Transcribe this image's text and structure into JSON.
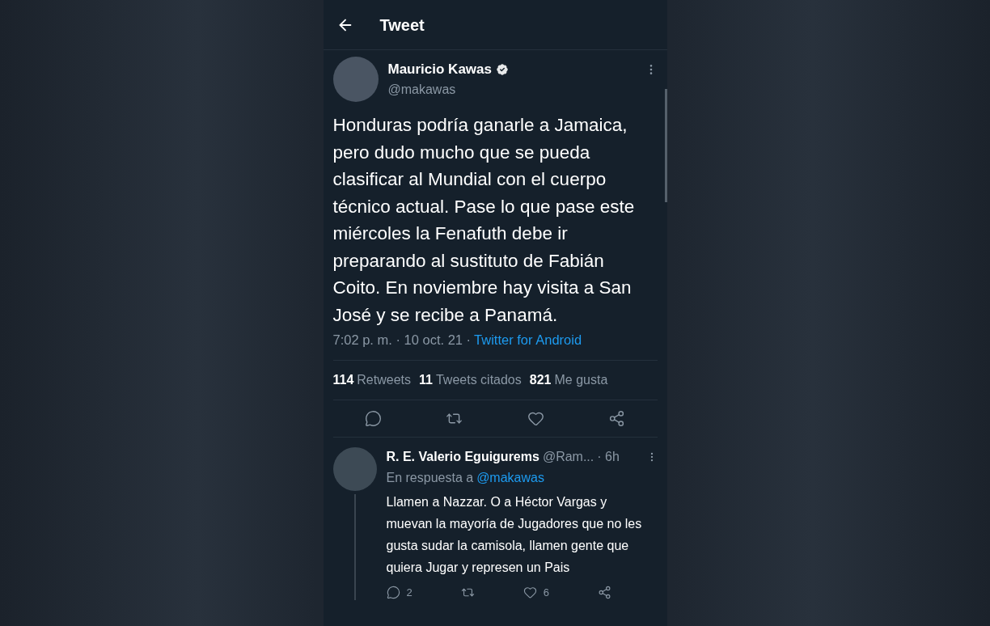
{
  "header": {
    "title": "Tweet"
  },
  "tweet": {
    "name": "Mauricio Kawas",
    "verified": true,
    "handle": "@makawas",
    "text": "Honduras podría ganarle a Jamaica, pero dudo mucho que se pueda clasificar al Mundial con el cuerpo técnico actual. Pase lo que pase este miércoles la Fenafuth debe ir preparando al sustituto de Fabián Coito. En noviembre hay visita a San José y se recibe a Panamá.",
    "time": "7:02 p. m. · 10 oct. 21 ·",
    "source": "Twitter for Android",
    "stats": [
      {
        "count": "114",
        "label": "Retweets"
      },
      {
        "count": "11",
        "label": "Tweets citados"
      },
      {
        "count": "821",
        "label": "Me gusta"
      }
    ],
    "actions": [
      {
        "kind": "reply"
      },
      {
        "kind": "retweet"
      },
      {
        "kind": "like"
      },
      {
        "kind": "share"
      }
    ]
  },
  "reply": {
    "name": "R. E. Valerio Eguigurems",
    "handle": "@Ram...",
    "time": "· 6h",
    "in_reply_prefix": "En respuesta a",
    "in_reply_to": "@makawas",
    "text": "Llamen a Nazzar. O a Héctor Vargas y muevan la mayoría de Jugadores que no les gusta sudar la camisola, llamen gente que quiera Jugar y represen un Pais",
    "actions": [
      {
        "kind": "reply",
        "count": "2"
      },
      {
        "kind": "retweet"
      },
      {
        "kind": "like",
        "count": "6"
      },
      {
        "kind": "share"
      }
    ]
  }
}
